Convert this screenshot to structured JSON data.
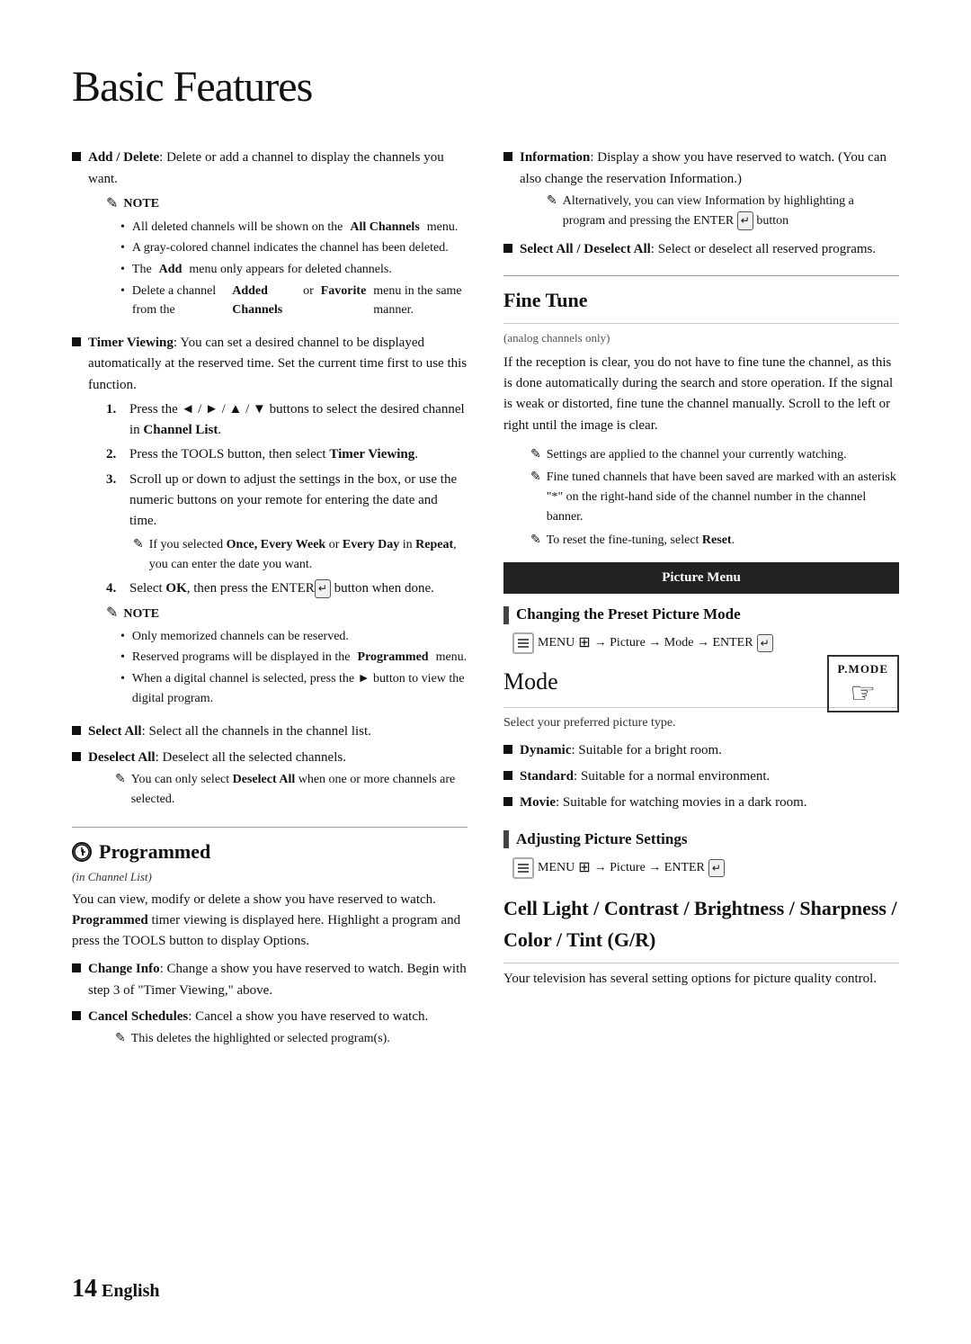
{
  "page": {
    "title": "Basic Features",
    "footer": {
      "page_number": "14",
      "language": "English"
    }
  },
  "left_col": {
    "add_delete": {
      "label": "Add / Delete",
      "text": ": Delete or add a channel to display the channels you want.",
      "note_label": "NOTE",
      "subbullets": [
        "All deleted channels will be shown on the <b>All Channels</b> menu.",
        "A gray-colored channel indicates the channel has been deleted.",
        "The <b>Add</b> menu only appears for deleted channels.",
        "Delete a channel from the <b>Added Channels</b> or <b>Favorite</b> menu in the same manner."
      ]
    },
    "timer_viewing": {
      "label": "Timer Viewing",
      "text": ": You can set a desired channel to be displayed automatically at the reserved time. Set the current time first to use this function.",
      "steps": [
        {
          "num": "1.",
          "text": "Press the ◄ / ► / ▲ / ▼ buttons to select the desired channel in <b>Channel List</b>."
        },
        {
          "num": "2.",
          "text": "Press the TOOLS button, then select <b>Timer Viewing</b>."
        },
        {
          "num": "3.",
          "text": "Scroll up or down to adjust the settings in the box, or use the numeric buttons on your remote for entering the date and time."
        },
        {
          "num": "4.",
          "text": "Select <b>OK</b>, then press the ENTER button when done."
        }
      ],
      "step3_sub_note": "If you selected <b>Once, Every Week</b> or <b>Every Day</b> in <b>Repeat</b>, you can enter the date you want.",
      "note2_label": "NOTE",
      "note2_bullets": [
        "Only memorized channels can be reserved.",
        "Reserved programs will be displayed in the <b>Programmed</b> menu.",
        "When a digital channel is selected, press the ► button to view the digital program."
      ]
    },
    "select_all": {
      "label": "Select All",
      "text": ": Select all the channels in the channel list."
    },
    "deselect_all": {
      "label": "Deselect All",
      "text": ": Deselect all the selected channels.",
      "sub_note": "You can only select <b>Deselect All</b> when one or more channels are selected."
    },
    "programmed_section": {
      "heading": "Programmed",
      "sub_label": "(in Channel List)",
      "description": "You can view, modify or delete a show you have reserved to watch. <b>Programmed</b> timer viewing is displayed here. Highlight a program and press the TOOLS button to display Options.",
      "items": [
        {
          "label": "Change Info",
          "text": ": Change a show you have reserved to watch. Begin with step 3 of \"Timer Viewing,\" above."
        },
        {
          "label": "Cancel Schedules",
          "text": ": Cancel a show you have reserved to watch.",
          "sub_note": "This deletes the highlighted or selected program(s)."
        }
      ]
    }
  },
  "right_col": {
    "information": {
      "label": "Information",
      "text": ": Display a show you have reserved to watch. (You can also change the reservation Information.)",
      "sub_note": "Alternatively, you can view Information by highlighting a program and pressing the ENTER button"
    },
    "select_all_deselect": {
      "label": "Select All / Deselect All",
      "text": ": Select or deselect all reserved programs."
    },
    "fine_tune": {
      "heading": "Fine Tune",
      "analog_note": "(analog channels only)",
      "description": "If the reception is clear, you do not have to fine tune the channel, as this is done automatically during the search and store operation. If the signal is weak or distorted, fine tune the channel manually. Scroll to the left or right until the image is clear.",
      "note1": "Settings are applied to the channel your currently watching.",
      "note2": "Fine tuned channels that have been saved are marked with an asterisk \"*\" on the right-hand side of the channel number in the channel banner.",
      "note3": "To reset the fine-tuning, select <b>Reset</b>."
    },
    "picture_menu": {
      "bar_label": "Picture Menu",
      "changing_preset": {
        "heading": "Changing the Preset Picture Mode",
        "menu_path": "MENU → Picture → Mode → ENTER"
      },
      "mode": {
        "heading": "Mode",
        "subtext": "Select your preferred picture type.",
        "items": [
          {
            "label": "Dynamic",
            "text": ": Suitable for a bright room."
          },
          {
            "label": "Standard",
            "text": ": Suitable for a normal environment."
          },
          {
            "label": "Movie",
            "text": ": Suitable for watching movies in a dark room."
          }
        ],
        "badge_text": "P.MODE",
        "badge_hand": "☞"
      },
      "adjusting": {
        "heading": "Adjusting Picture Settings",
        "menu_path": "MENU → Picture → ENTER"
      },
      "cell_light": {
        "heading": "Cell Light / Contrast / Brightness / Sharpness / Color / Tint (G/R)",
        "description": "Your television has several setting options for picture quality control."
      }
    }
  }
}
